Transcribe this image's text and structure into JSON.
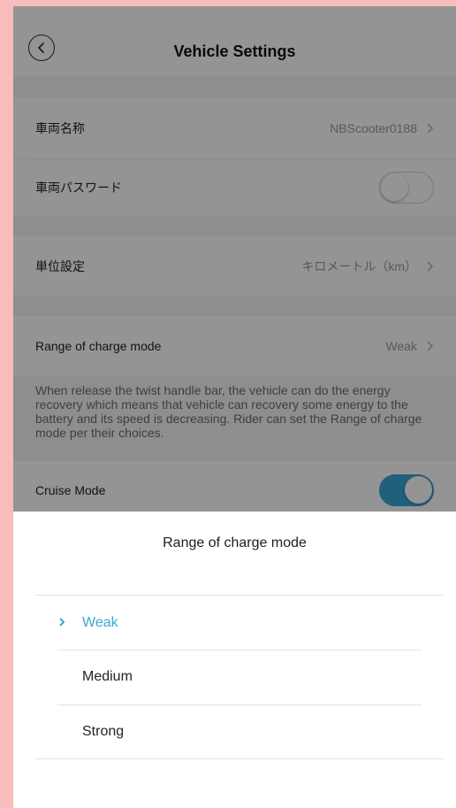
{
  "header": {
    "title": "Vehicle Settings"
  },
  "settings": {
    "vehicle_name": {
      "label": "車両名称",
      "value": "NBScooter0188"
    },
    "vehicle_password": {
      "label": "車両パスワード",
      "enabled": false
    },
    "unit_setting": {
      "label": "単位設定",
      "value": "キロメートル（km）"
    },
    "charge_mode": {
      "label": "Range of charge mode",
      "value": "Weak"
    },
    "charge_mode_description": "When release the twist handle bar, the vehicle can do the energy recovery which means that vehicle can recovery some energy to the battery and its speed is decreasing. Rider can set the Range of charge mode per their choices.",
    "cruise_mode": {
      "label": "Cruise Mode",
      "enabled": true
    }
  },
  "sheet": {
    "title": "Range of charge mode",
    "options": [
      {
        "label": "Weak",
        "selected": true
      },
      {
        "label": "Medium",
        "selected": false
      },
      {
        "label": "Strong",
        "selected": false
      }
    ]
  },
  "colors": {
    "accent": "#3aa6d6",
    "frame": "#f8bcbd"
  }
}
